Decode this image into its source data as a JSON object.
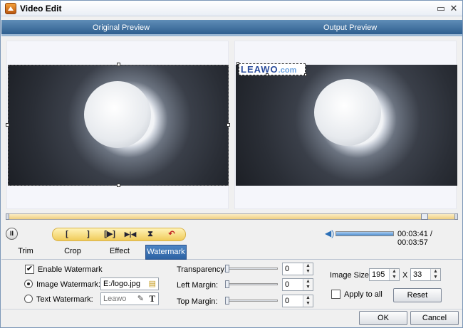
{
  "window": {
    "title": "Video Edit",
    "minimize_glyph": "▭",
    "close_glyph": "✕"
  },
  "preview": {
    "original_label": "Original Preview",
    "output_label": "Output Preview"
  },
  "watermark_preview": {
    "text_main": "LEAWO",
    "text_suffix": ".com"
  },
  "toolbar": {
    "buttons": [
      {
        "name": "mark-in-icon",
        "glyph": "["
      },
      {
        "name": "mark-out-icon",
        "glyph": "]"
      },
      {
        "name": "play-selection-icon",
        "glyph": "[▶]"
      },
      {
        "name": "to-start-icon",
        "glyph": "▶|◀"
      },
      {
        "name": "trim-icon",
        "glyph": "⧗"
      },
      {
        "name": "undo-icon",
        "glyph": "↶"
      }
    ]
  },
  "playback": {
    "pause_glyph": "II",
    "time_current": "00:03:41",
    "time_separator": "/",
    "time_total": "00:03:57",
    "volume_glyph": "◀)"
  },
  "tabs": [
    {
      "label": "Trim",
      "active": false
    },
    {
      "label": "Crop",
      "active": false
    },
    {
      "label": "Effect",
      "active": false
    },
    {
      "label": "Watermark",
      "active": true
    }
  ],
  "watermark": {
    "enable_label": "Enable Watermark",
    "enable_checked": "✔",
    "image_label": "Image Watermark:",
    "image_path": "E:/logo.jpg",
    "text_label": "Text Watermark:",
    "text_value": "Leawo",
    "pen_glyph": "✎",
    "font_glyph": "T",
    "folder_glyph": "▤",
    "transparency_label": "Transparency:",
    "transparency_value": "0",
    "left_margin_label": "Left Margin:",
    "left_margin_value": "0",
    "top_margin_label": "Top  Margin:",
    "top_margin_value": "0",
    "image_size_label": "Image Size:",
    "image_width": "195",
    "size_separator": "X",
    "image_height": "33",
    "apply_all_label": "Apply to all",
    "reset_label": "Reset"
  },
  "footer": {
    "ok_label": "OK",
    "cancel_label": "Cancel"
  }
}
